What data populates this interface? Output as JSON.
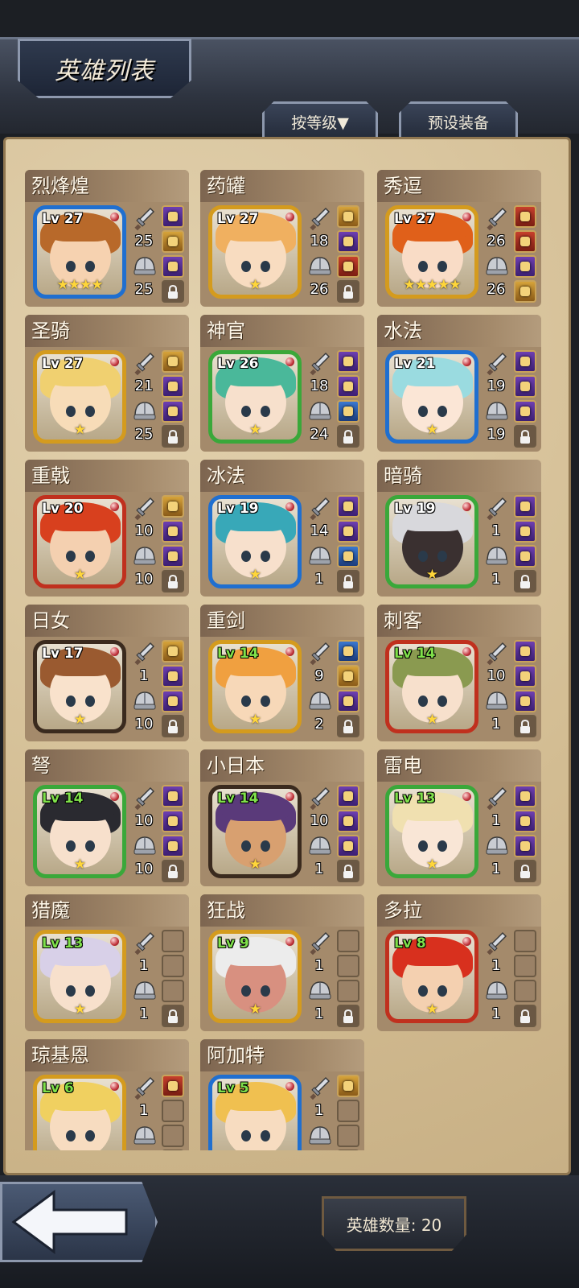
{
  "header": {
    "title": "英雄列表",
    "sort_button": "按等级▼",
    "preset_button": "预设装备"
  },
  "footer": {
    "hero_count": "英雄数量: 20"
  },
  "heroes": [
    {
      "name": "烈烽煌",
      "level": "Lv 27",
      "attack": "25",
      "defense": "25",
      "stars": "★★★★",
      "frame": "#1f6fd0",
      "hair": "#b8692a",
      "skin": "#f6d2b0",
      "lvColor": "#ffffff",
      "slots": [
        "purple",
        "gold",
        "purple",
        "lock"
      ]
    },
    {
      "name": "药罐",
      "level": "Lv 27",
      "attack": "18",
      "defense": "26",
      "stars": "★",
      "frame": "#d49b1e",
      "hair": "#f0b060",
      "skin": "#f8dcc0",
      "lvColor": "#ffffff",
      "slots": [
        "gold",
        "purple",
        "red",
        "lock"
      ]
    },
    {
      "name": "秀逗",
      "level": "Lv 27",
      "attack": "26",
      "defense": "26",
      "stars": "★★★★★",
      "frame": "#d49b1e",
      "hair": "#e0601a",
      "skin": "#f9dcc6",
      "lvColor": "#ffffff",
      "slots": [
        "red",
        "red",
        "purple",
        "gold"
      ]
    },
    {
      "name": "圣骑",
      "level": "Lv 27",
      "attack": "21",
      "defense": "25",
      "stars": "★",
      "frame": "#d49b1e",
      "hair": "#f0d070",
      "skin": "#f7dcb8",
      "lvColor": "#ffffff",
      "slots": [
        "gold",
        "purple",
        "purple",
        "lock"
      ]
    },
    {
      "name": "神官",
      "level": "Lv 26",
      "attack": "18",
      "defense": "24",
      "stars": "★",
      "frame": "#3aa83a",
      "hair": "#4ab89a",
      "skin": "#f7e0cc",
      "lvColor": "#ffffff",
      "slots": [
        "purple",
        "purple",
        "blue",
        "lock"
      ]
    },
    {
      "name": "水法",
      "level": "Lv 21",
      "attack": "19",
      "defense": "19",
      "stars": "★",
      "frame": "#1f6fd0",
      "hair": "#9adbe0",
      "skin": "#fbe6d6",
      "lvColor": "#ffffff",
      "slots": [
        "purple",
        "purple",
        "purple",
        "lock"
      ]
    },
    {
      "name": "重戟",
      "level": "Lv 20",
      "attack": "10",
      "defense": "10",
      "stars": "★",
      "frame": "#c0301e",
      "hair": "#d8401e",
      "skin": "#f4d0b0",
      "lvColor": "#ffffff",
      "slots": [
        "gold",
        "purple",
        "purple",
        "lock"
      ]
    },
    {
      "name": "冰法",
      "level": "Lv 19",
      "attack": "14",
      "defense": "1",
      "stars": "★",
      "frame": "#1f6fd0",
      "hair": "#38a8b8",
      "skin": "#f7e0cc",
      "lvColor": "#ffffff",
      "slots": [
        "purple",
        "purple",
        "blue",
        "lock"
      ]
    },
    {
      "name": "暗骑",
      "level": "Lv 19",
      "attack": "1",
      "defense": "1",
      "stars": "★",
      "frame": "#3aa83a",
      "hair": "#d8d8dc",
      "skin": "#3a3030",
      "lvColor": "#ffffff",
      "slots": [
        "purple",
        "purple",
        "purple",
        "lock"
      ]
    },
    {
      "name": "日女",
      "level": "Lv 17",
      "attack": "1",
      "defense": "10",
      "stars": "★",
      "frame": "#3a2a1e",
      "hair": "#9a5a30",
      "skin": "#f9e2cc",
      "lvColor": "#ffffff",
      "slots": [
        "gold",
        "purple",
        "purple",
        "lock"
      ]
    },
    {
      "name": "重剑",
      "level": "Lv 14",
      "attack": "9",
      "defense": "2",
      "stars": "★",
      "frame": "#d49b1e",
      "hair": "#f0a040",
      "skin": "#f7d8b8",
      "lvColor": "#7fe04a",
      "slots": [
        "blue",
        "gold",
        "purple",
        "lock"
      ]
    },
    {
      "name": "刺客",
      "level": "Lv 14",
      "attack": "10",
      "defense": "1",
      "stars": "★",
      "frame": "#c0301e",
      "hair": "#8a9a50",
      "skin": "#f7e0cc",
      "lvColor": "#7fe04a",
      "slots": [
        "purple",
        "purple",
        "purple",
        "lock"
      ]
    },
    {
      "name": "弩",
      "level": "Lv 14",
      "attack": "10",
      "defense": "10",
      "stars": "★",
      "frame": "#3aa83a",
      "hair": "#2a2a30",
      "skin": "#f7e0cc",
      "lvColor": "#7fe04a",
      "slots": [
        "purple",
        "purple",
        "purple",
        "lock"
      ]
    },
    {
      "name": "小日本",
      "level": "Lv 14",
      "attack": "10",
      "defense": "1",
      "stars": "★",
      "frame": "#3a2a1e",
      "hair": "#5a3a7a",
      "skin": "#d8a070",
      "lvColor": "#7fe04a",
      "slots": [
        "purple",
        "purple",
        "purple",
        "lock"
      ]
    },
    {
      "name": "雷电",
      "level": "Lv 13",
      "attack": "1",
      "defense": "1",
      "stars": "★",
      "frame": "#3aa83a",
      "hair": "#f0e0b0",
      "skin": "#f9e6d6",
      "lvColor": "#7fe04a",
      "slots": [
        "purple",
        "purple",
        "purple",
        "lock"
      ]
    },
    {
      "name": "猎魔",
      "level": "Lv 13",
      "attack": "1",
      "defense": "1",
      "stars": "★",
      "frame": "#d49b1e",
      "hair": "#d8d0e8",
      "skin": "#f7e0cc",
      "lvColor": "#7fe04a",
      "slots": [
        "empty",
        "empty",
        "empty",
        "lock"
      ]
    },
    {
      "name": "狂战",
      "level": "Lv 9",
      "attack": "1",
      "defense": "1",
      "stars": "★",
      "frame": "#d49b1e",
      "hair": "#ececec",
      "skin": "#d89080",
      "lvColor": "#7fe04a",
      "slots": [
        "empty",
        "empty",
        "empty",
        "lock"
      ]
    },
    {
      "name": "多拉",
      "level": "Lv 8",
      "attack": "1",
      "defense": "1",
      "stars": "★",
      "frame": "#c0301e",
      "hair": "#d8301e",
      "skin": "#f4d0b0",
      "lvColor": "#7fe04a",
      "slots": [
        "empty",
        "empty",
        "empty",
        "lock"
      ]
    },
    {
      "name": "琼基恩",
      "level": "Lv 6",
      "attack": "1",
      "defense": "",
      "stars": "",
      "frame": "#d49b1e",
      "hair": "#f0d060",
      "skin": "#f7dcc0",
      "lvColor": "#7fe04a",
      "slots": [
        "red",
        "empty",
        "empty",
        "empty"
      ]
    },
    {
      "name": "阿加特",
      "level": "Lv 5",
      "attack": "1",
      "defense": "",
      "stars": "",
      "frame": "#1f6fd0",
      "hair": "#f0c050",
      "skin": "#f7dcc0",
      "lvColor": "#7fe04a",
      "slots": [
        "gold",
        "empty",
        "empty",
        "empty"
      ]
    }
  ]
}
